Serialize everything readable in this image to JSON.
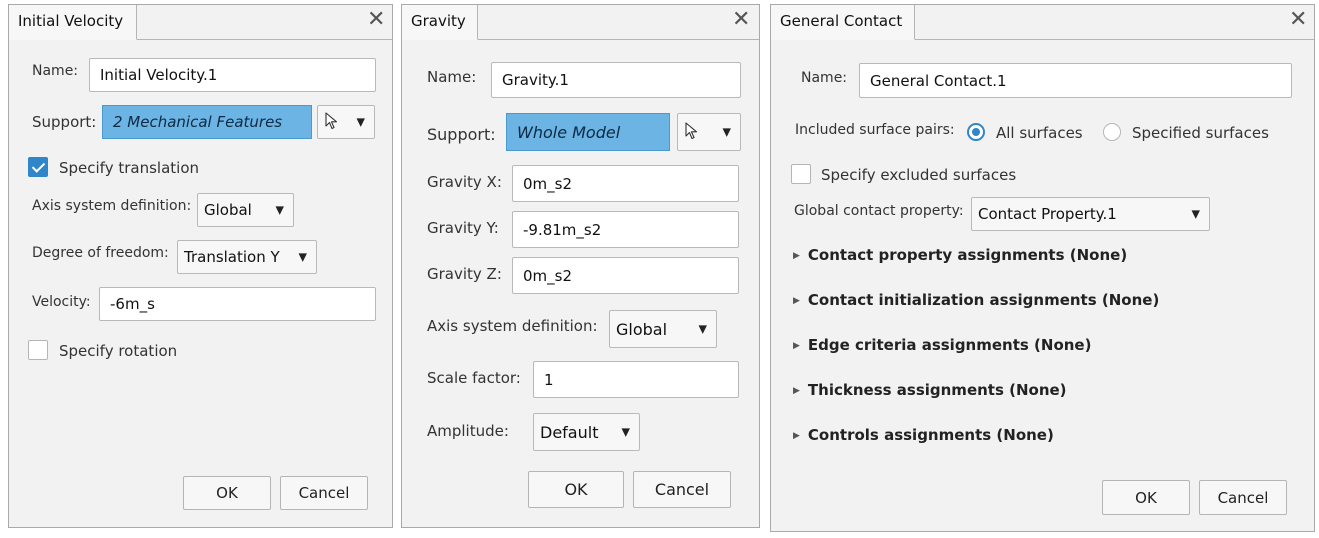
{
  "initial_velocity": {
    "tab_title": "Initial Velocity",
    "close_glyph": "✕",
    "name_label": "Name:",
    "name_value": "Initial Velocity.1",
    "support_label": "Support:",
    "support_value": "2 Mechanical Features",
    "specify_translation_label": "Specify translation",
    "specify_translation_checked": true,
    "axis_label": "Axis system definition:",
    "axis_value": "Global",
    "dof_label": "Degree of freedom:",
    "dof_value": "Translation Y",
    "velocity_label": "Velocity:",
    "velocity_value": "-6m_s",
    "specify_rotation_label": "Specify rotation",
    "specify_rotation_checked": false,
    "ok_label": "OK",
    "cancel_label": "Cancel"
  },
  "gravity": {
    "tab_title": "Gravity",
    "close_glyph": "✕",
    "name_label": "Name:",
    "name_value": "Gravity.1",
    "support_label": "Support:",
    "support_value": "Whole Model",
    "gx_label": "Gravity X:",
    "gx_value": "0m_s2",
    "gy_label": "Gravity Y:",
    "gy_value": "-9.81m_s2",
    "gz_label": "Gravity Z:",
    "gz_value": "0m_s2",
    "axis_label": "Axis system definition:",
    "axis_value": "Global",
    "scale_label": "Scale factor:",
    "scale_value": "1",
    "amplitude_label": "Amplitude:",
    "amplitude_value": "Default",
    "ok_label": "OK",
    "cancel_label": "Cancel"
  },
  "general_contact": {
    "tab_title": "General Contact",
    "close_glyph": "✕",
    "name_label": "Name:",
    "name_value": "General Contact.1",
    "included_label": "Included surface pairs:",
    "all_surfaces_label": "All surfaces",
    "specified_surfaces_label": "Specified surfaces",
    "selected_option": "All surfaces",
    "exclude_label": "Specify excluded surfaces",
    "exclude_checked": false,
    "global_prop_label": "Global contact property:",
    "global_prop_value": "Contact Property.1",
    "sections": [
      "Contact property assignments (None)",
      "Contact initialization assignments (None)",
      "Edge criteria assignments (None)",
      "Thickness assignments (None)",
      "Controls assignments (None)"
    ],
    "ok_label": "OK",
    "cancel_label": "Cancel"
  },
  "icons": {
    "close": "close-icon",
    "cursor": "cursor-arrow-icon",
    "dropdown": "chevron-down-icon",
    "expand": "triangle-right-icon"
  }
}
